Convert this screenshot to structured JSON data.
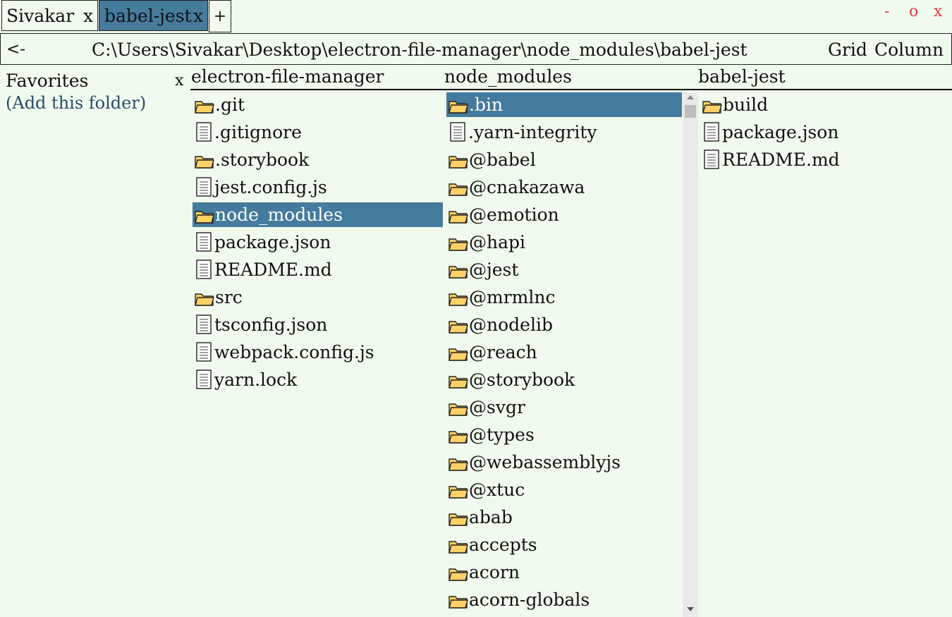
{
  "tabs": [
    {
      "label": "Sivakar",
      "close": "x",
      "active": false
    },
    {
      "label": "babel-jest",
      "close": "x",
      "active": true
    }
  ],
  "new_tab_label": "+",
  "window_controls": {
    "minimize": "-",
    "maximize": "o",
    "close": "x"
  },
  "pathbar": {
    "back_label": "<-",
    "path": "C:\\Users\\Sivakar\\Desktop\\electron-file-manager\\node_modules\\babel-jest",
    "view_grid": "Grid",
    "view_column": "Column"
  },
  "favorites": {
    "title": "Favorites",
    "add_label": "(Add this folder)",
    "close": "x"
  },
  "columns": [
    {
      "title": "electron-file-manager",
      "items": [
        {
          "name": ".git",
          "type": "folder"
        },
        {
          "name": ".gitignore",
          "type": "file"
        },
        {
          "name": ".storybook",
          "type": "folder"
        },
        {
          "name": "jest.config.js",
          "type": "file"
        },
        {
          "name": "node_modules",
          "type": "folder",
          "selected": true
        },
        {
          "name": "package.json",
          "type": "file"
        },
        {
          "name": "README.md",
          "type": "file"
        },
        {
          "name": "src",
          "type": "folder"
        },
        {
          "name": "tsconfig.json",
          "type": "file"
        },
        {
          "name": "webpack.config.js",
          "type": "file"
        },
        {
          "name": "yarn.lock",
          "type": "file"
        }
      ]
    },
    {
      "title": "node_modules",
      "items": [
        {
          "name": ".bin",
          "type": "folder",
          "selected": true
        },
        {
          "name": ".yarn-integrity",
          "type": "file"
        },
        {
          "name": "@babel",
          "type": "folder"
        },
        {
          "name": "@cnakazawa",
          "type": "folder"
        },
        {
          "name": "@emotion",
          "type": "folder"
        },
        {
          "name": "@hapi",
          "type": "folder"
        },
        {
          "name": "@jest",
          "type": "folder"
        },
        {
          "name": "@mrmlnc",
          "type": "folder"
        },
        {
          "name": "@nodelib",
          "type": "folder"
        },
        {
          "name": "@reach",
          "type": "folder"
        },
        {
          "name": "@storybook",
          "type": "folder"
        },
        {
          "name": "@svgr",
          "type": "folder"
        },
        {
          "name": "@types",
          "type": "folder"
        },
        {
          "name": "@webassemblyjs",
          "type": "folder"
        },
        {
          "name": "@xtuc",
          "type": "folder"
        },
        {
          "name": "abab",
          "type": "folder"
        },
        {
          "name": "accepts",
          "type": "folder"
        },
        {
          "name": "acorn",
          "type": "folder"
        },
        {
          "name": "acorn-globals",
          "type": "folder"
        }
      ]
    },
    {
      "title": "babel-jest",
      "items": [
        {
          "name": "build",
          "type": "folder"
        },
        {
          "name": "package.json",
          "type": "file"
        },
        {
          "name": "README.md",
          "type": "file"
        }
      ]
    }
  ],
  "colors": {
    "background": "#f1faee",
    "selection": "#457b9d",
    "window_controls": "#e63946",
    "folder_fill": "#ffd166",
    "link": "#274c6b"
  }
}
